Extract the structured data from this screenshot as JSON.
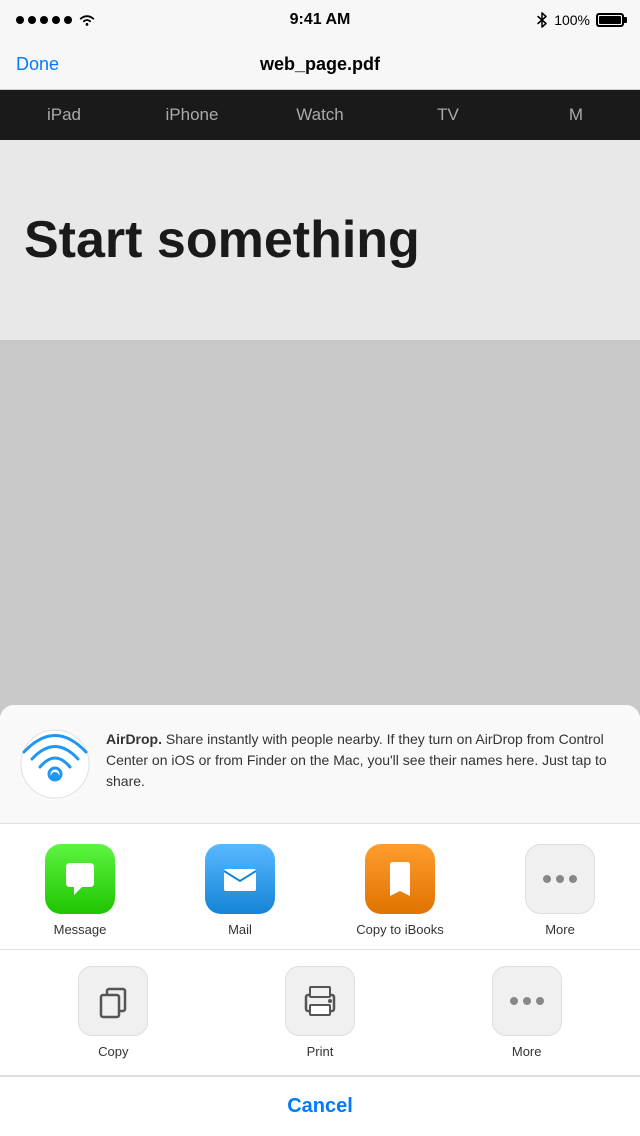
{
  "status": {
    "time": "9:41 AM",
    "battery_percent": "100%",
    "signal_dots": 5
  },
  "navbar": {
    "done_label": "Done",
    "title": "web_page.pdf"
  },
  "tabs": {
    "items": [
      {
        "label": "iPad"
      },
      {
        "label": "iPhone"
      },
      {
        "label": "Watch"
      },
      {
        "label": "TV"
      },
      {
        "label": "M"
      }
    ]
  },
  "page": {
    "heading": "Start something"
  },
  "airdrop": {
    "title": "AirDrop.",
    "description": " Share instantly with people nearby. If they turn on AirDrop from Control Center on iOS or from Finder on the Mac, you'll see their names here. Just tap to share."
  },
  "share_apps": [
    {
      "id": "message",
      "label": "Message"
    },
    {
      "id": "mail",
      "label": "Mail"
    },
    {
      "id": "ibooks",
      "label": "Copy to iBooks"
    },
    {
      "id": "more-apps",
      "label": "More"
    }
  ],
  "actions": [
    {
      "id": "copy",
      "label": "Copy"
    },
    {
      "id": "print",
      "label": "Print"
    },
    {
      "id": "more",
      "label": "More"
    }
  ],
  "cancel_label": "Cancel"
}
